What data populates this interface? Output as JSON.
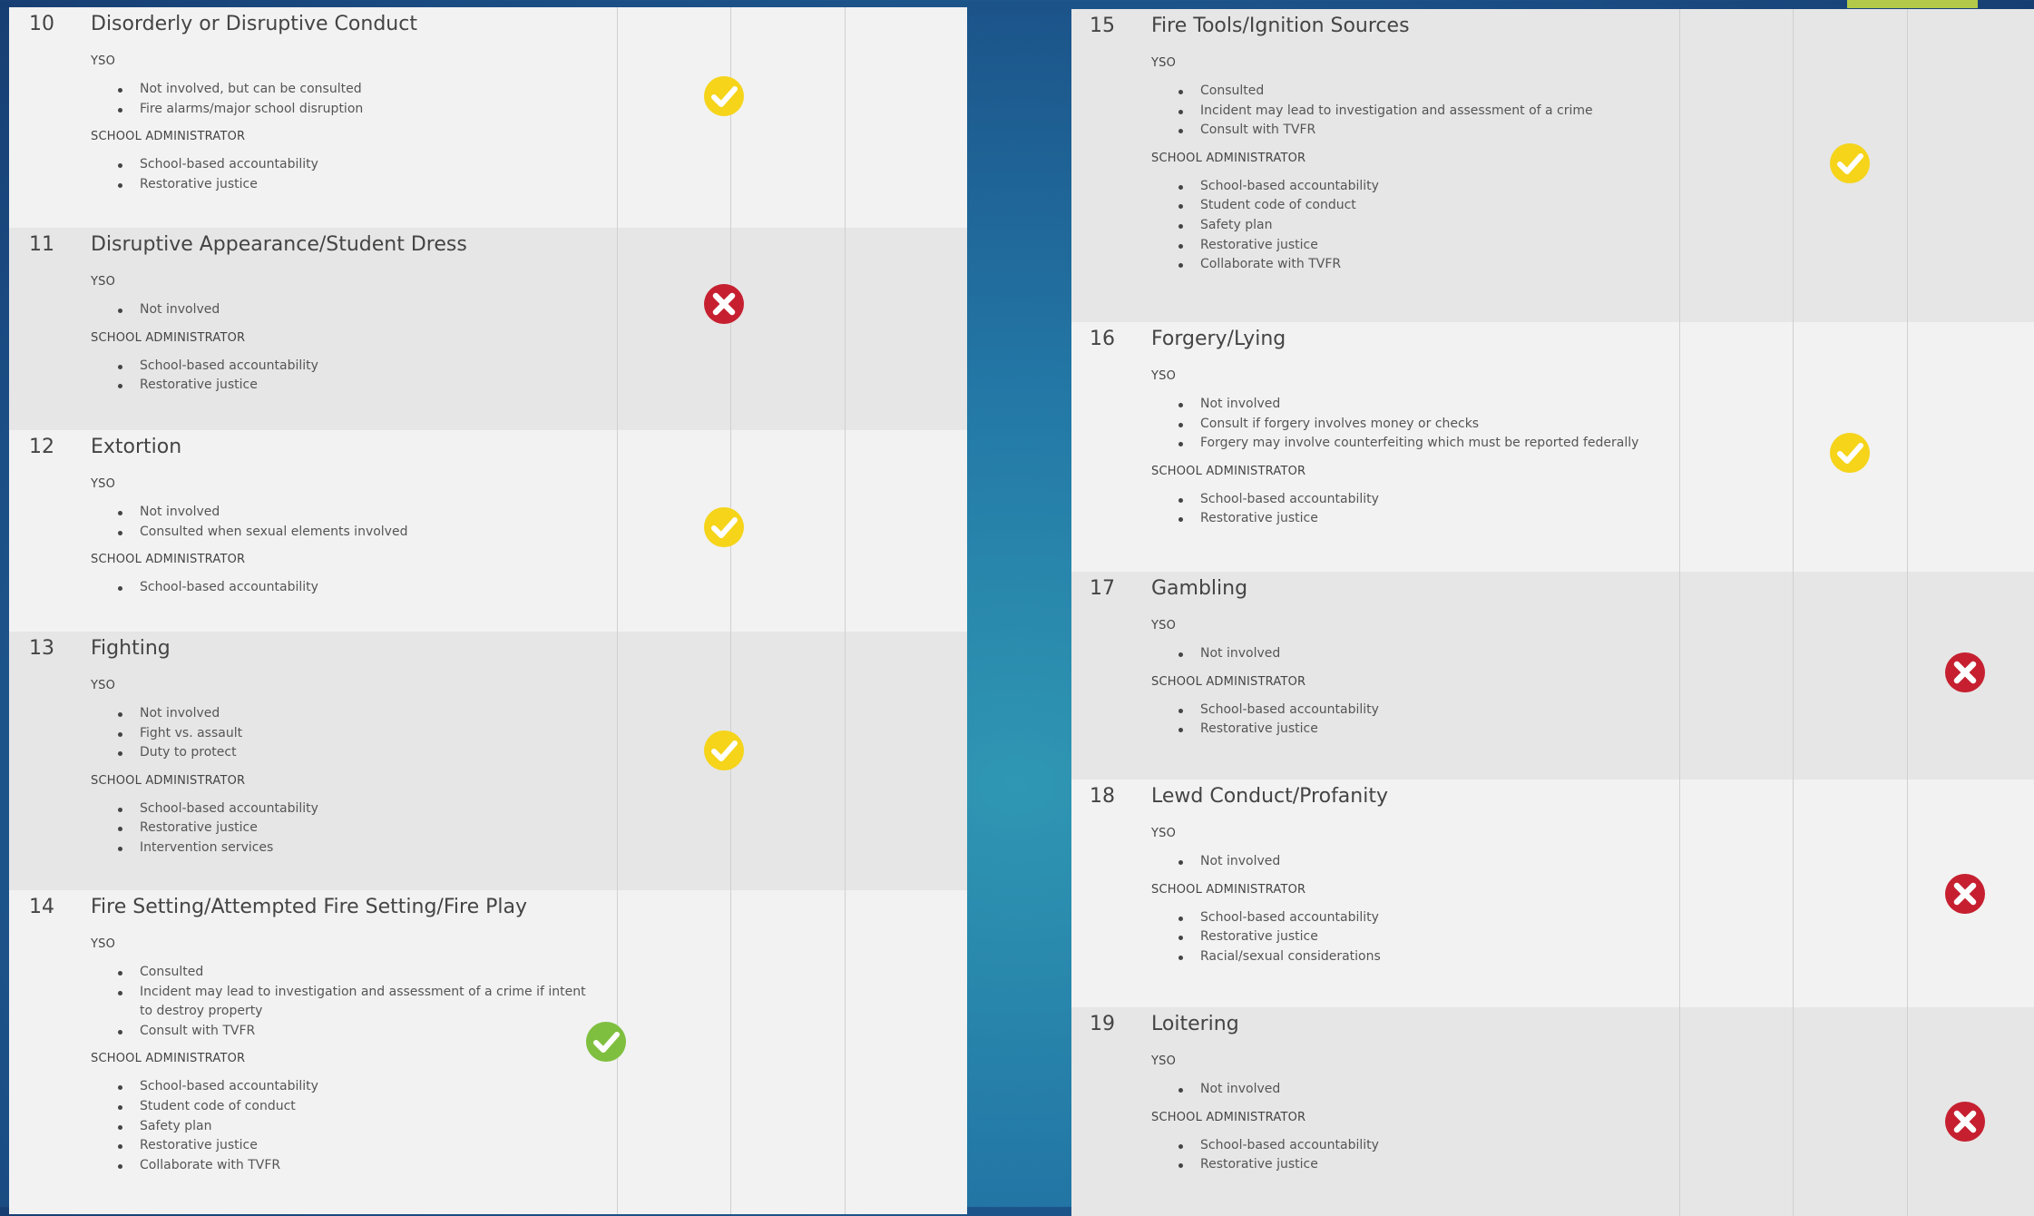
{
  "colors": {
    "yellow_check": "#f5d41a",
    "green_check": "#7fbf3f",
    "red_x": "#c62030",
    "accent_bar": "#b3c94a",
    "panel_bg": "#f2f2f2",
    "row_shade": "#e6e6e6"
  },
  "left": {
    "rows": [
      {
        "num": "10",
        "title": "Disorderly or Disruptive Conduct",
        "yso_label": "YSO",
        "yso": [
          "Not involved, but can be consulted",
          "Fire alarms/major school disruption"
        ],
        "admin_label": "SCHOOL ADMINISTRATOR",
        "admin": [
          "School-based accountability",
          "Restorative justice"
        ],
        "icon": "yellow-check-icon"
      },
      {
        "num": "11",
        "title": "Disruptive Appearance/Student Dress",
        "yso_label": "YSO",
        "yso": [
          "Not involved"
        ],
        "admin_label": "SCHOOL ADMINISTRATOR",
        "admin": [
          "School-based accountability",
          "Restorative justice"
        ],
        "icon": "red-x-icon"
      },
      {
        "num": "12",
        "title": "Extortion",
        "yso_label": "YSO",
        "yso": [
          "Not involved",
          "Consulted when sexual elements involved"
        ],
        "admin_label": "SCHOOL ADMINISTRATOR",
        "admin": [
          "School-based accountability"
        ],
        "icon": "yellow-check-icon"
      },
      {
        "num": "13",
        "title": "Fighting",
        "yso_label": "YSO",
        "yso": [
          "Not involved",
          "Fight vs. assault",
          "Duty to protect"
        ],
        "admin_label": "SCHOOL ADMINISTRATOR",
        "admin": [
          "School-based accountability",
          "Restorative justice",
          "Intervention services"
        ],
        "icon": "yellow-check-icon"
      },
      {
        "num": "14",
        "title": "Fire Setting/Attempted Fire Setting/Fire Play",
        "yso_label": "YSO",
        "yso": [
          "Consulted",
          "Incident may lead to investigation and assessment of a crime if intent to destroy property",
          "Consult with TVFR"
        ],
        "admin_label": "SCHOOL ADMINISTRATOR",
        "admin": [
          "School-based accountability",
          "Student code of conduct",
          "Safety plan",
          "Restorative justice",
          "Collaborate with TVFR"
        ],
        "icon": "green-check-icon"
      }
    ]
  },
  "right": {
    "rows": [
      {
        "num": "15",
        "title": "Fire Tools/Ignition Sources",
        "yso_label": "YSO",
        "yso": [
          "Consulted",
          "Incident may lead to investigation and assessment of a crime",
          "Consult with TVFR"
        ],
        "admin_label": "SCHOOL ADMINISTRATOR",
        "admin": [
          "School-based accountability",
          "Student code of conduct",
          "Safety plan",
          "Restorative justice",
          "Collaborate with TVFR"
        ],
        "icon": "yellow-check-icon"
      },
      {
        "num": "16",
        "title": "Forgery/Lying",
        "yso_label": "YSO",
        "yso": [
          "Not involved",
          "Consult if forgery involves money or checks",
          "Forgery may involve counterfeiting which must be reported federally"
        ],
        "admin_label": "SCHOOL ADMINISTRATOR",
        "admin": [
          "School-based accountability",
          "Restorative justice"
        ],
        "icon": "yellow-check-icon"
      },
      {
        "num": "17",
        "title": "Gambling",
        "yso_label": "YSO",
        "yso": [
          "Not involved"
        ],
        "admin_label": "SCHOOL ADMINISTRATOR",
        "admin": [
          "School-based accountability",
          "Restorative justice"
        ],
        "icon": "red-x-icon"
      },
      {
        "num": "18",
        "title": "Lewd Conduct/Profanity",
        "yso_label": "YSO",
        "yso": [
          "Not involved"
        ],
        "admin_label": "SCHOOL ADMINISTRATOR",
        "admin": [
          "School-based accountability",
          "Restorative justice",
          "Racial/sexual considerations"
        ],
        "icon": "red-x-icon"
      },
      {
        "num": "19",
        "title": "Loitering",
        "yso_label": "YSO",
        "yso": [
          "Not involved"
        ],
        "admin_label": "SCHOOL ADMINISTRATOR",
        "admin": [
          "School-based accountability",
          "Restorative justice"
        ],
        "icon": "red-x-icon"
      }
    ]
  }
}
